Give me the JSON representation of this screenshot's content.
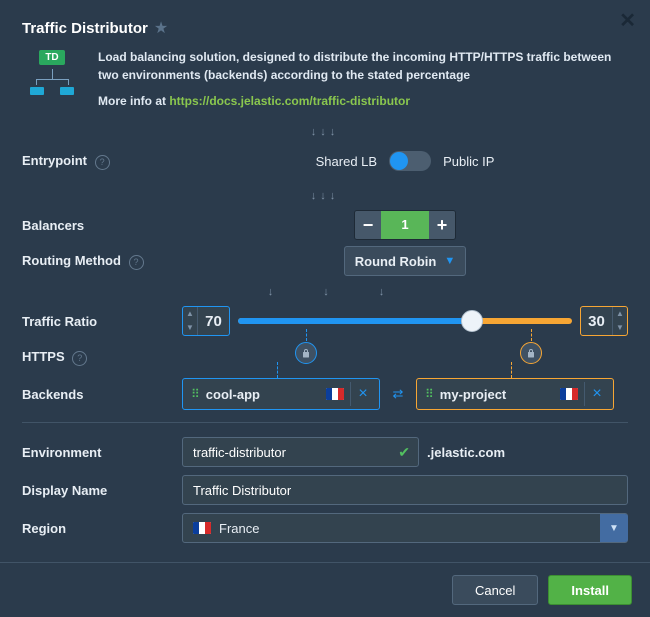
{
  "header": {
    "title": "Traffic Distributor"
  },
  "description": {
    "line1": "Load balancing solution, designed to distribute the incoming HTTP/HTTPS traffic between two environments (backends) according to the stated percentage",
    "more_prefix": "More info at ",
    "more_link": "https://docs.jelastic.com/traffic-distributor"
  },
  "labels": {
    "entrypoint": "Entrypoint",
    "balancers": "Balancers",
    "routing": "Routing Method",
    "ratio": "Traffic Ratio",
    "https": "HTTPS",
    "backends": "Backends",
    "environment": "Environment",
    "display_name": "Display Name",
    "region": "Region"
  },
  "entrypoint": {
    "left": "Shared LB",
    "right": "Public IP"
  },
  "balancers": {
    "value": "1"
  },
  "routing": {
    "value": "Round Robin"
  },
  "ratio": {
    "left": "70",
    "right": "30"
  },
  "backends": {
    "left": "cool-app",
    "right": "my-project"
  },
  "env": {
    "name": "traffic-distributor",
    "suffix": ".jelastic.com",
    "display": "Traffic Distributor"
  },
  "region": {
    "value": "France"
  },
  "buttons": {
    "cancel": "Cancel",
    "install": "Install"
  },
  "icons": {
    "td_badge": "TD"
  }
}
